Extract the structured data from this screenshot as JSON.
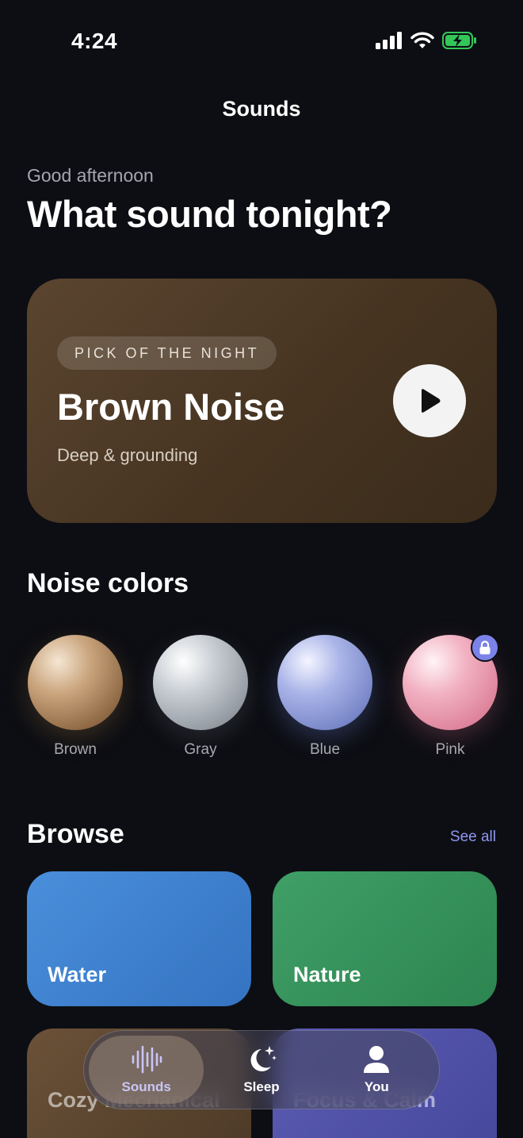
{
  "status": {
    "time": "4:24"
  },
  "nav": {
    "title": "Sounds"
  },
  "header": {
    "greeting": "Good afternoon",
    "headline": "What sound tonight?"
  },
  "hero": {
    "badge": "PICK OF THE NIGHT",
    "title": "Brown Noise",
    "subtitle": "Deep & grounding",
    "play_icon": "play-icon"
  },
  "noise_colors": {
    "title": "Noise colors",
    "items": [
      {
        "label": "Brown",
        "color": "#b08a62",
        "locked": false
      },
      {
        "label": "Gray",
        "color": "#a7adb4",
        "locked": false
      },
      {
        "label": "Blue",
        "color": "#8f9ad6",
        "locked": false
      },
      {
        "label": "Pink",
        "color": "#e999ae",
        "locked": true
      }
    ]
  },
  "browse": {
    "title": "Browse",
    "see_all": "See all",
    "tiles": [
      {
        "label": "Water",
        "color": "#3f82d0"
      },
      {
        "label": "Nature",
        "color": "#36925b"
      },
      {
        "label": "Cozy Mechanical",
        "color": "#5c4530"
      },
      {
        "label": "Focus & Calm",
        "color": "#4f50a6"
      }
    ]
  },
  "tabbar": {
    "tabs": [
      {
        "label": "Sounds",
        "icon": "waveform-icon",
        "active": true
      },
      {
        "label": "Sleep",
        "icon": "moon-stars-icon",
        "active": false
      },
      {
        "label": "You",
        "icon": "person-icon",
        "active": false
      }
    ]
  },
  "colors": {
    "background": "#0d0e13",
    "accent": "#8f96f3",
    "lock_badge": "#7b82e8"
  }
}
